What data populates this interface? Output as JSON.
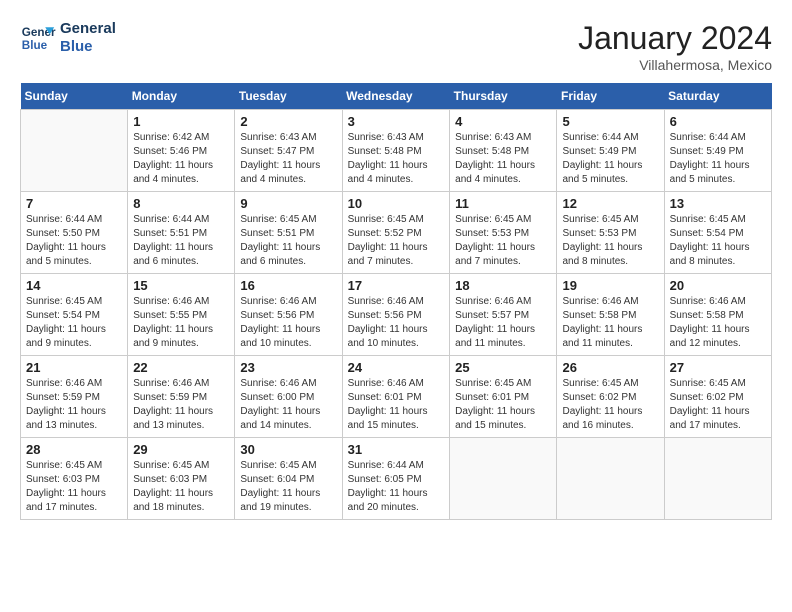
{
  "header": {
    "logo_line1": "General",
    "logo_line2": "Blue",
    "month_title": "January 2024",
    "subtitle": "Villahermosa, Mexico"
  },
  "weekdays": [
    "Sunday",
    "Monday",
    "Tuesday",
    "Wednesday",
    "Thursday",
    "Friday",
    "Saturday"
  ],
  "weeks": [
    [
      {
        "day": null,
        "info": null
      },
      {
        "day": "1",
        "info": "Sunrise: 6:42 AM\nSunset: 5:46 PM\nDaylight: 11 hours\nand 4 minutes."
      },
      {
        "day": "2",
        "info": "Sunrise: 6:43 AM\nSunset: 5:47 PM\nDaylight: 11 hours\nand 4 minutes."
      },
      {
        "day": "3",
        "info": "Sunrise: 6:43 AM\nSunset: 5:48 PM\nDaylight: 11 hours\nand 4 minutes."
      },
      {
        "day": "4",
        "info": "Sunrise: 6:43 AM\nSunset: 5:48 PM\nDaylight: 11 hours\nand 4 minutes."
      },
      {
        "day": "5",
        "info": "Sunrise: 6:44 AM\nSunset: 5:49 PM\nDaylight: 11 hours\nand 5 minutes."
      },
      {
        "day": "6",
        "info": "Sunrise: 6:44 AM\nSunset: 5:49 PM\nDaylight: 11 hours\nand 5 minutes."
      }
    ],
    [
      {
        "day": "7",
        "info": "Sunrise: 6:44 AM\nSunset: 5:50 PM\nDaylight: 11 hours\nand 5 minutes."
      },
      {
        "day": "8",
        "info": "Sunrise: 6:44 AM\nSunset: 5:51 PM\nDaylight: 11 hours\nand 6 minutes."
      },
      {
        "day": "9",
        "info": "Sunrise: 6:45 AM\nSunset: 5:51 PM\nDaylight: 11 hours\nand 6 minutes."
      },
      {
        "day": "10",
        "info": "Sunrise: 6:45 AM\nSunset: 5:52 PM\nDaylight: 11 hours\nand 7 minutes."
      },
      {
        "day": "11",
        "info": "Sunrise: 6:45 AM\nSunset: 5:53 PM\nDaylight: 11 hours\nand 7 minutes."
      },
      {
        "day": "12",
        "info": "Sunrise: 6:45 AM\nSunset: 5:53 PM\nDaylight: 11 hours\nand 8 minutes."
      },
      {
        "day": "13",
        "info": "Sunrise: 6:45 AM\nSunset: 5:54 PM\nDaylight: 11 hours\nand 8 minutes."
      }
    ],
    [
      {
        "day": "14",
        "info": "Sunrise: 6:45 AM\nSunset: 5:54 PM\nDaylight: 11 hours\nand 9 minutes."
      },
      {
        "day": "15",
        "info": "Sunrise: 6:46 AM\nSunset: 5:55 PM\nDaylight: 11 hours\nand 9 minutes."
      },
      {
        "day": "16",
        "info": "Sunrise: 6:46 AM\nSunset: 5:56 PM\nDaylight: 11 hours\nand 10 minutes."
      },
      {
        "day": "17",
        "info": "Sunrise: 6:46 AM\nSunset: 5:56 PM\nDaylight: 11 hours\nand 10 minutes."
      },
      {
        "day": "18",
        "info": "Sunrise: 6:46 AM\nSunset: 5:57 PM\nDaylight: 11 hours\nand 11 minutes."
      },
      {
        "day": "19",
        "info": "Sunrise: 6:46 AM\nSunset: 5:58 PM\nDaylight: 11 hours\nand 11 minutes."
      },
      {
        "day": "20",
        "info": "Sunrise: 6:46 AM\nSunset: 5:58 PM\nDaylight: 11 hours\nand 12 minutes."
      }
    ],
    [
      {
        "day": "21",
        "info": "Sunrise: 6:46 AM\nSunset: 5:59 PM\nDaylight: 11 hours\nand 13 minutes."
      },
      {
        "day": "22",
        "info": "Sunrise: 6:46 AM\nSunset: 5:59 PM\nDaylight: 11 hours\nand 13 minutes."
      },
      {
        "day": "23",
        "info": "Sunrise: 6:46 AM\nSunset: 6:00 PM\nDaylight: 11 hours\nand 14 minutes."
      },
      {
        "day": "24",
        "info": "Sunrise: 6:46 AM\nSunset: 6:01 PM\nDaylight: 11 hours\nand 15 minutes."
      },
      {
        "day": "25",
        "info": "Sunrise: 6:45 AM\nSunset: 6:01 PM\nDaylight: 11 hours\nand 15 minutes."
      },
      {
        "day": "26",
        "info": "Sunrise: 6:45 AM\nSunset: 6:02 PM\nDaylight: 11 hours\nand 16 minutes."
      },
      {
        "day": "27",
        "info": "Sunrise: 6:45 AM\nSunset: 6:02 PM\nDaylight: 11 hours\nand 17 minutes."
      }
    ],
    [
      {
        "day": "28",
        "info": "Sunrise: 6:45 AM\nSunset: 6:03 PM\nDaylight: 11 hours\nand 17 minutes."
      },
      {
        "day": "29",
        "info": "Sunrise: 6:45 AM\nSunset: 6:03 PM\nDaylight: 11 hours\nand 18 minutes."
      },
      {
        "day": "30",
        "info": "Sunrise: 6:45 AM\nSunset: 6:04 PM\nDaylight: 11 hours\nand 19 minutes."
      },
      {
        "day": "31",
        "info": "Sunrise: 6:44 AM\nSunset: 6:05 PM\nDaylight: 11 hours\nand 20 minutes."
      },
      {
        "day": null,
        "info": null
      },
      {
        "day": null,
        "info": null
      },
      {
        "day": null,
        "info": null
      }
    ]
  ]
}
